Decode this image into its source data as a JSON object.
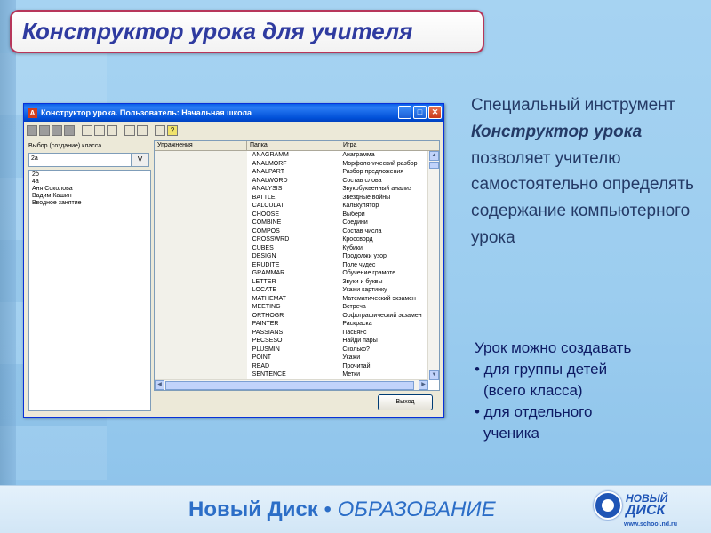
{
  "slide": {
    "title": "Конструктор урока для учителя"
  },
  "window": {
    "title": "Конструктор урока. Пользователь: Начальная школа",
    "minimize": "_",
    "maximize": "□",
    "close": "✕"
  },
  "left_pane": {
    "label": "Выбор (создание) класса",
    "input_value": "2а",
    "combo_button": "V",
    "items": [
      "2б",
      "4а",
      "Аня Соколова",
      "Вадим Кашин",
      "Вводное занятие"
    ]
  },
  "grid": {
    "headers": [
      "Упражнения",
      "Папка",
      "Игра"
    ],
    "rows": [
      [
        "",
        "ANAGRAMM",
        "Анаграмма"
      ],
      [
        "",
        "ANALMORF",
        "Морфологический разбор"
      ],
      [
        "",
        "ANALPART",
        "Разбор предложения"
      ],
      [
        "",
        "ANALWORD",
        "Состав слова"
      ],
      [
        "",
        "ANALYSIS",
        "Звукобуквенный анализ"
      ],
      [
        "",
        "BATTLE",
        "Звездные войны"
      ],
      [
        "",
        "CALCULAT",
        "Калькулятор"
      ],
      [
        "",
        "CHOOSE",
        "Выбери"
      ],
      [
        "",
        "COMBINE",
        "Соедини"
      ],
      [
        "",
        "COMPOS",
        "Состав числа"
      ],
      [
        "",
        "CROSSWRD",
        "Кроссворд"
      ],
      [
        "",
        "CUBES",
        "Кубики"
      ],
      [
        "",
        "DESIGN",
        "Продолжи узор"
      ],
      [
        "",
        "ERUDITE",
        "Поле чудес"
      ],
      [
        "",
        "GRAMMAR",
        "Обучение грамоте"
      ],
      [
        "",
        "LETTER",
        "Звуки и буквы"
      ],
      [
        "",
        "LOCATE",
        "Укажи картинку"
      ],
      [
        "",
        "MATHEMAT",
        "Математический экзамен"
      ],
      [
        "",
        "MEETING",
        "Встреча"
      ],
      [
        "",
        "ORTHOGR",
        "Орфографический экзамен"
      ],
      [
        "",
        "PAINTER",
        "Раскраска"
      ],
      [
        "",
        "PASSIANS",
        "Пасьянс"
      ],
      [
        "",
        "PECSESO",
        "Найди пары"
      ],
      [
        "",
        "PLUSMIN",
        "Сколько?"
      ],
      [
        "",
        "POINT",
        "Укажи"
      ],
      [
        "",
        "READ",
        "Прочитай"
      ],
      [
        "",
        "SENTENCE",
        "Метки"
      ]
    ]
  },
  "exit_button": "Выход",
  "description": {
    "line1": "Специальный инструмент",
    "emphasis": "Конструктор урока",
    "line2": "позволяет учителю самостоятельно определять содержание компьютерного урока"
  },
  "bullets": {
    "head": "Урок можно создавать",
    "item1": "• для группы детей",
    "item1_cont": "(всего класса)",
    "item2": "• для отдельного",
    "item2_cont": "ученика"
  },
  "footer": {
    "brand": "Новый Диск",
    "dot": " • ",
    "edu": "ОБРАЗОВАНИЕ",
    "logo_line1": "НОВЫЙ",
    "logo_line2": "ДИСК",
    "logo_url": "www.school.nd.ru"
  },
  "colors": {
    "title_border": "#b7365a",
    "title_text": "#2f3ba0",
    "footer_brand": "#2c6ec7"
  }
}
